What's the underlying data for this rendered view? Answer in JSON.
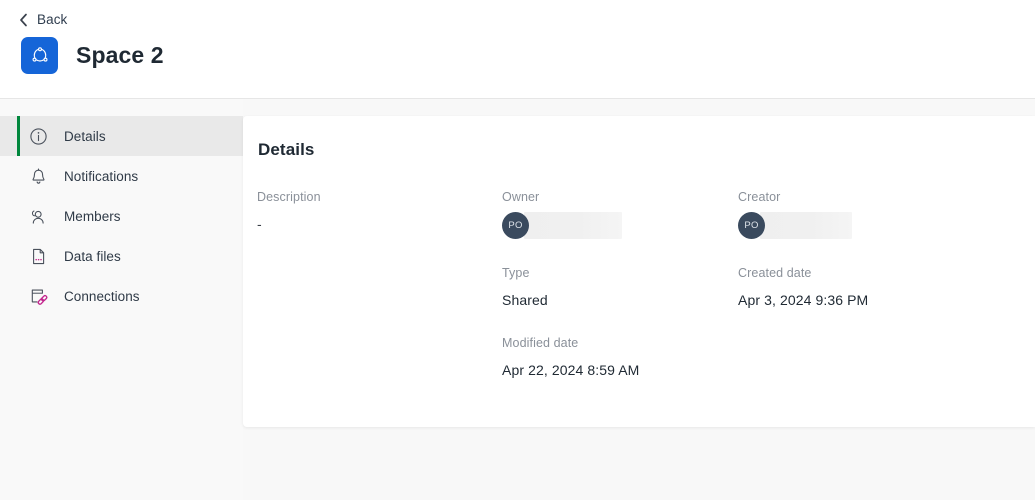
{
  "header": {
    "back_label": "Back",
    "space_title": "Space 2",
    "badge_icon": "space-glyph-icon",
    "badge_color": "#1565d8"
  },
  "sidebar": {
    "items": [
      {
        "label": "Details",
        "icon": "info-circle-icon",
        "active": true
      },
      {
        "label": "Notifications",
        "icon": "bell-icon",
        "active": false
      },
      {
        "label": "Members",
        "icon": "users-icon",
        "active": false
      },
      {
        "label": "Data files",
        "icon": "file-data-icon",
        "active": false
      },
      {
        "label": "Connections",
        "icon": "connections-icon",
        "active": false
      }
    ],
    "active_accent_color": "#00873d",
    "active_background": "#e9e9e9"
  },
  "main": {
    "title": "Details",
    "fields": {
      "description": {
        "label": "Description",
        "value": "-"
      },
      "owner": {
        "label": "Owner",
        "avatar_initials": "PO",
        "value_redacted": true
      },
      "creator": {
        "label": "Creator",
        "avatar_initials": "PO",
        "value_redacted": true
      },
      "type": {
        "label": "Type",
        "value": "Shared"
      },
      "created_date": {
        "label": "Created date",
        "value": "Apr 3, 2024 9:36 PM"
      },
      "modified_date": {
        "label": "Modified date",
        "value": "Apr 22, 2024 8:59 AM"
      }
    },
    "avatar_color": "#3a4a5e"
  }
}
